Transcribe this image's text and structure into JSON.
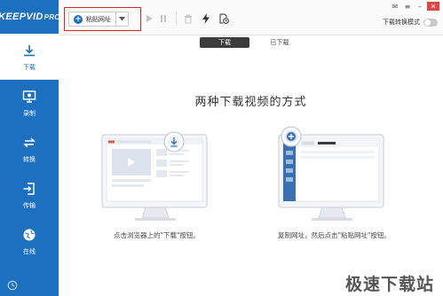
{
  "app": {
    "brand": "KEEPVID",
    "brand_suffix": "PRO"
  },
  "sidebar": {
    "items": [
      {
        "label": "下载",
        "icon": "download-icon"
      },
      {
        "label": "录制",
        "icon": "record-icon"
      },
      {
        "label": "转换",
        "icon": "convert-icon"
      },
      {
        "label": "传输",
        "icon": "transfer-icon"
      },
      {
        "label": "在线",
        "icon": "online-icon"
      }
    ],
    "active_index": 0
  },
  "toolbar": {
    "paste_label": "粘贴网址",
    "mode_label": "下载转换模式",
    "mode_on": false
  },
  "tabs": {
    "downloading": "下载",
    "downloaded": "已下载"
  },
  "main": {
    "title": "两种下载视频的方式",
    "caption_left": "点击浏览器上的\"下载\"按钮。",
    "caption_right": "复制网址，然后点击\"粘贴网址\"按钮。"
  },
  "watermark": "极速下载站",
  "colors": {
    "sidebar": "#1d6fc0",
    "highlight": "#d8262b",
    "active_tab": "#3c3c3c"
  }
}
